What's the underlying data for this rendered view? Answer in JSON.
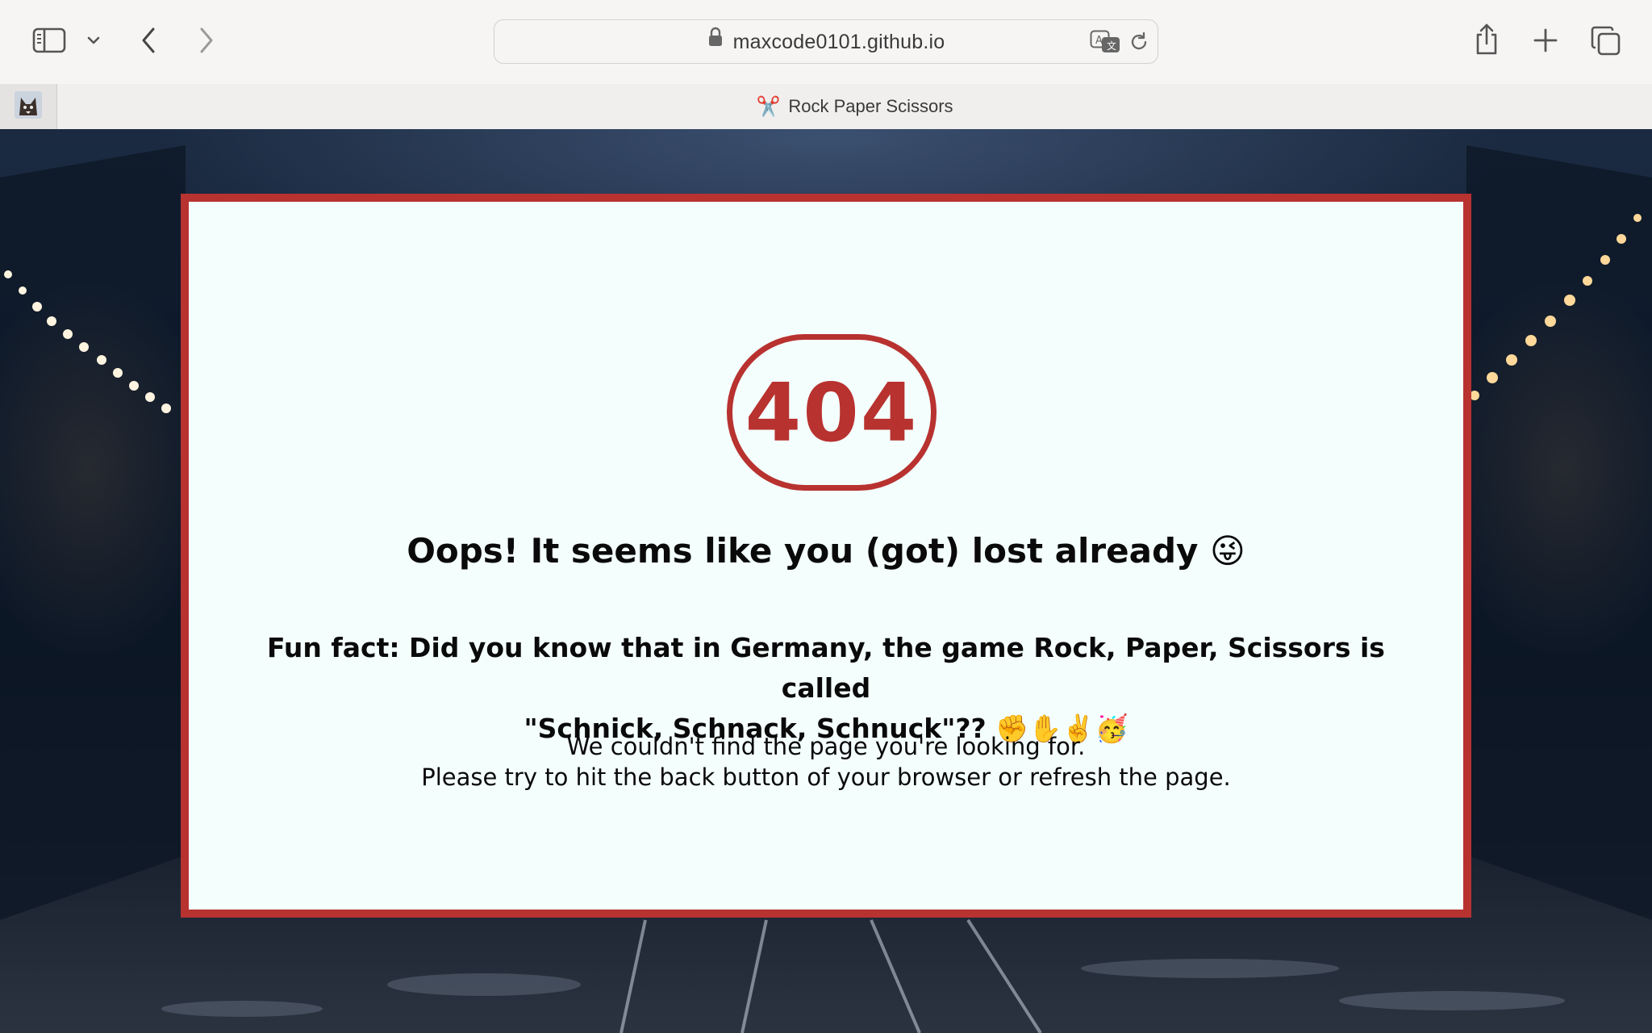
{
  "browser": {
    "url": "maxcode0101.github.io",
    "active_tab": {
      "icon": "scissors-icon",
      "glyph": "✂️",
      "title": "Rock Paper Scissors"
    },
    "pinned_tab": {
      "icon": "favicon-icon"
    }
  },
  "error": {
    "code": "404",
    "headline": "Oops! It seems like you (got) lost already 😜",
    "fun_fact_line1": "Fun fact: Did you know that in Germany, the game Rock, Paper, Scissors is called",
    "fun_fact_line2": "\"Schnick, Schnack, Schnuck\"?? ✊✋✌️🥳",
    "message_line1": "We couldn't find the page you're looking for.",
    "message_line2": "Please try to hit the back button of your browser or refresh the page."
  },
  "colors": {
    "accent": "#b83230",
    "card_bg": "#f4fffd"
  }
}
